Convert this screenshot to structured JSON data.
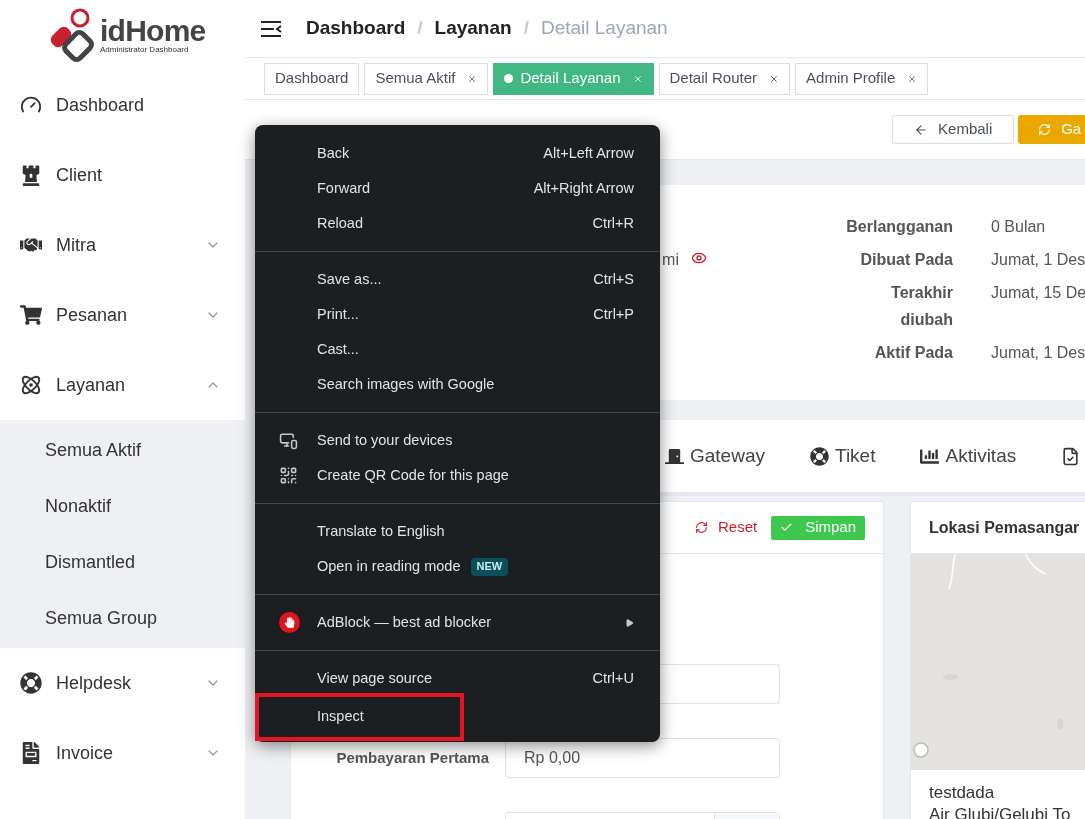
{
  "brand": {
    "name": "idHome",
    "tagline": "Administrator Dashboard"
  },
  "sidebar": {
    "items": [
      {
        "label": "Dashboard",
        "kind": "dashboard"
      },
      {
        "label": "Client",
        "kind": "client"
      },
      {
        "label": "Mitra",
        "kind": "partner",
        "expanded": false
      },
      {
        "label": "Pesanan",
        "kind": "cart",
        "expanded": false
      },
      {
        "label": "Layanan",
        "kind": "service",
        "expanded": true,
        "children": [
          {
            "label": "Semua Aktif"
          },
          {
            "label": "Nonaktif"
          },
          {
            "label": "Dismantled"
          },
          {
            "label": "Semua Group"
          }
        ]
      },
      {
        "label": "Helpdesk",
        "kind": "helpdesk",
        "expanded": false
      },
      {
        "label": "Invoice",
        "kind": "invoice",
        "expanded": false
      }
    ]
  },
  "breadcrumb": [
    {
      "label": "Dashboard",
      "current": false
    },
    {
      "separator": "/"
    },
    {
      "label": "Layanan",
      "current": false
    },
    {
      "separator": "/"
    },
    {
      "label": "Detail Layanan",
      "current": true
    }
  ],
  "open_tabs": [
    {
      "label": "Dashboard",
      "selected": false,
      "closable": false
    },
    {
      "label": "Semua Aktif",
      "selected": false,
      "closable": true
    },
    {
      "label": "Detail Layanan",
      "selected": true,
      "closable": true
    },
    {
      "label": "Detail Router",
      "selected": false,
      "closable": true
    },
    {
      "label": "Admin Profile",
      "selected": false,
      "closable": true
    }
  ],
  "actions": [
    {
      "label": "Kembali",
      "kind": "back"
    },
    {
      "label": "Ga",
      "kind": "change"
    }
  ],
  "summary": {
    "left_fragment": "mi",
    "details": [
      {
        "label": "Berlangganan",
        "value": "0 Bulan"
      },
      {
        "label": "Dibuat Pada",
        "value": "Jumat, 1 Des"
      },
      {
        "label": "Terakhir diubah",
        "value": "Jumat, 15 De"
      },
      {
        "label": "Aktif Pada",
        "value": "Jumat, 1 Des"
      }
    ]
  },
  "detail_tabs": [
    {
      "label": "Gateway",
      "kind": "gateway"
    },
    {
      "label": "Tiket",
      "kind": "ticket"
    },
    {
      "label": "Aktivitas",
      "kind": "activity"
    },
    {
      "kind": "document"
    }
  ],
  "form": {
    "reset": "Reset",
    "save": "Simpan",
    "fields": [
      {
        "kind": "text"
      },
      {
        "kind": "text",
        "label": "Pembayaran Pertama",
        "value": "Rp 0,00"
      },
      {
        "kind": "addon"
      }
    ]
  },
  "location": {
    "title": "Lokasi Pemasangar",
    "name": "testdada",
    "address": "Air Glubi/Gelubi To"
  },
  "context_menu": {
    "groups": [
      [
        {
          "label": "Back",
          "shortcut": "Alt+Left Arrow",
          "kind": "plain",
          "highlighted": false
        },
        {
          "label": "Forward",
          "shortcut": "Alt+Right Arrow",
          "kind": "plain",
          "highlighted": false
        },
        {
          "label": "Reload",
          "shortcut": "Ctrl+R",
          "kind": "plain",
          "highlighted": false
        }
      ],
      [
        {
          "label": "Save as...",
          "shortcut": "Ctrl+S",
          "kind": "plain",
          "highlighted": false
        },
        {
          "label": "Print...",
          "shortcut": "Ctrl+P",
          "kind": "plain",
          "highlighted": false
        },
        {
          "label": "Cast...",
          "kind": "plain",
          "highlighted": false
        },
        {
          "label": "Search images with Google",
          "kind": "plain",
          "highlighted": false
        }
      ],
      [
        {
          "label": "Send to your devices",
          "kind": "devices",
          "highlighted": false
        },
        {
          "label": "Create QR Code for this page",
          "kind": "qr",
          "highlighted": false
        }
      ],
      [
        {
          "label": "Translate to English",
          "kind": "plain",
          "highlighted": false
        },
        {
          "label": "Open in reading mode",
          "badge": "NEW",
          "kind": "plain",
          "highlighted": false
        }
      ],
      [
        {
          "label": "AdBlock — best ad blocker",
          "kind": "extension",
          "submenu": true,
          "highlighted": false
        }
      ],
      [
        {
          "label": "View page source",
          "shortcut": "Ctrl+U",
          "kind": "plain",
          "highlighted": false
        },
        {
          "label": "Inspect",
          "kind": "plain",
          "highlighted": true
        }
      ]
    ]
  }
}
